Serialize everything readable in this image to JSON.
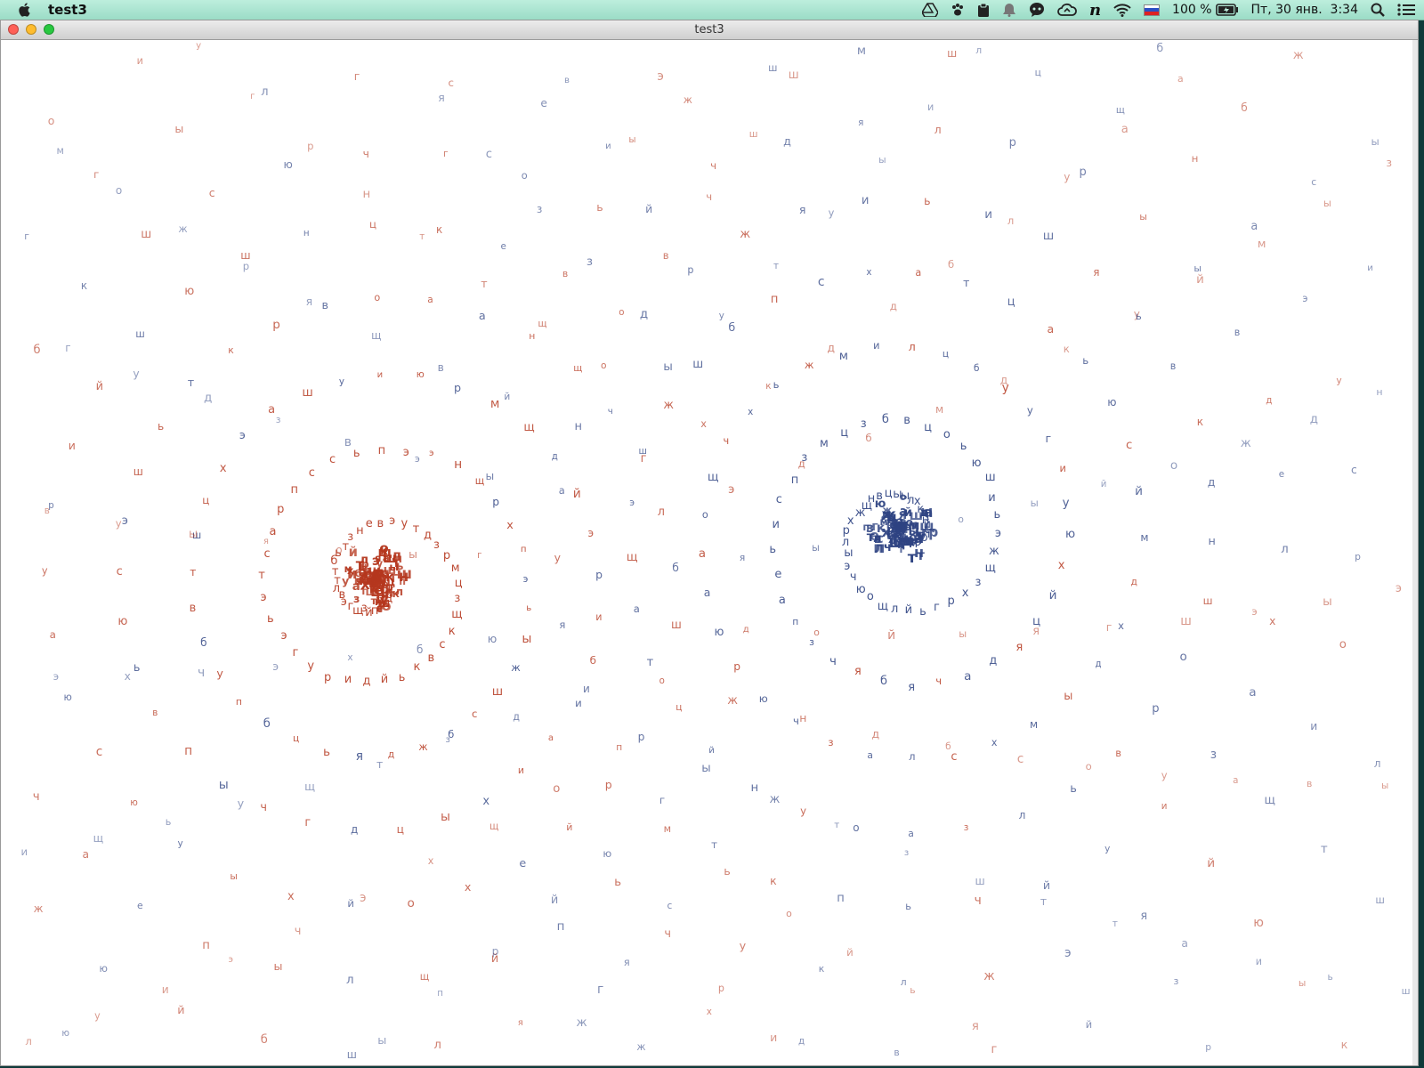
{
  "menubar": {
    "app_name": "test3",
    "battery": "100 %",
    "datetime": "Пт, 30 янв.  3:34",
    "icons": [
      "apple-icon",
      "google-drive-icon",
      "paw-icon",
      "clipboard-icon",
      "notification-icon",
      "chat-bubble-icon",
      "cloud-sync-icon",
      "n-app-icon",
      "wifi-icon",
      "russian-flag-icon",
      "battery-icon",
      "spotlight-search-icon",
      "list-menu-icon"
    ]
  },
  "window": {
    "title": "test3",
    "buttons": [
      "close-button",
      "minimize-button",
      "zoom-button"
    ]
  },
  "colors": {
    "red": "#b5371e",
    "blue": "#2e4382",
    "close": "#ff5f57",
    "minimize": "#febc2e",
    "zoom": "#28c840"
  },
  "canvas": {
    "description_letters": "аеиоунрстлвкдмпзбгчцщшжхйыьэюя",
    "letters_red": [
      "а",
      "з",
      "к",
      "а",
      "о",
      "й",
      "е",
      "ц",
      "е",
      "м",
      "п",
      "х",
      "ь",
      "ю",
      "ь",
      "в",
      "о",
      "л",
      "с",
      "о",
      "л",
      "з",
      "у",
      "ж",
      "н",
      "е",
      "р",
      "т",
      "и",
      "н",
      "ы",
      "в",
      "н",
      "е",
      "щ",
      "я",
      "в",
      "с",
      "м",
      "ж",
      "и",
      "к",
      "л",
      "б",
      "ж",
      "ц",
      "т",
      "е",
      "о",
      "а",
      "к",
      "с",
      "ы",
      "р",
      "ы",
      "м",
      "ч",
      "у",
      "р",
      "ж",
      "ь",
      "б",
      "и",
      "т",
      "е",
      "о",
      "с",
      "л",
      "д",
      "м",
      "о"
    ],
    "letters_blue": [
      "Н",
      "М",
      "Н",
      "Ю",
      "Т",
      "О",
      "Я",
      "П",
      "ы",
      "о",
      "т",
      "о",
      "ь",
      "м",
      "е",
      "к",
      "ж",
      "м",
      "о",
      "к",
      "ь",
      "л",
      "о",
      "е",
      "х",
      "ь",
      "с",
      "к",
      "н",
      "о",
      "п",
      "е",
      "с",
      "о",
      "р",
      "е",
      "ы",
      "м",
      "ь",
      "ш",
      "д",
      "в",
      "й",
      "ы",
      "е",
      "в",
      "л",
      "а",
      "и",
      "з",
      "в",
      "м",
      "у",
      "ш",
      "а",
      "ы",
      "н",
      "б",
      "о",
      "е",
      "й",
      "х",
      "р",
      "о",
      "о",
      "у",
      "ы",
      "н",
      "р"
    ]
  }
}
